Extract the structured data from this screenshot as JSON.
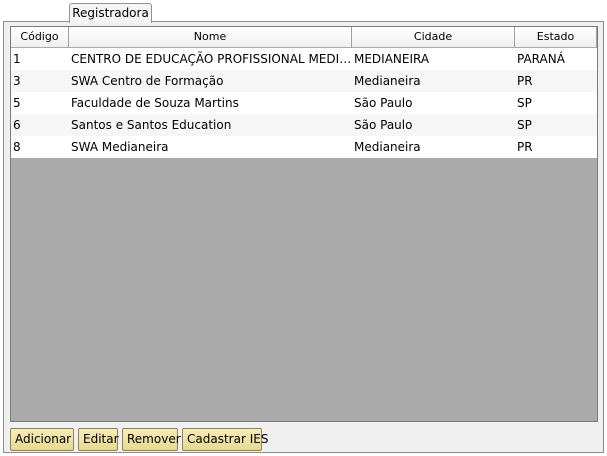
{
  "tab": {
    "label": "Registradora"
  },
  "table": {
    "columns": [
      "Código",
      "Nome",
      "Cidade",
      "Estado"
    ],
    "rows": [
      [
        "1",
        "CENTRO DE EDUCAÇÃO PROFISSIONAL MEDIANEI...",
        "MEDIANEIRA",
        "PARANÁ"
      ],
      [
        "3",
        "SWA Centro de Formação",
        "Medianeira",
        "PR"
      ],
      [
        "5",
        "Faculdade de Souza Martins",
        "São Paulo",
        "SP"
      ],
      [
        "6",
        "Santos e Santos Education",
        "São Paulo",
        "SP"
      ],
      [
        "8",
        "SWA Medianeira",
        "Medianeira",
        "PR"
      ]
    ]
  },
  "buttons": {
    "add": {
      "label": "Adicionar"
    },
    "edit": {
      "label": "Editar"
    },
    "remove": {
      "label": "Remover"
    },
    "register_ies": {
      "label": "Cadastrar IES"
    }
  },
  "colors": {
    "button_face": "#e7d98f",
    "grid_background": "#aaaaaa",
    "panel_background": "#f0f0f0"
  }
}
